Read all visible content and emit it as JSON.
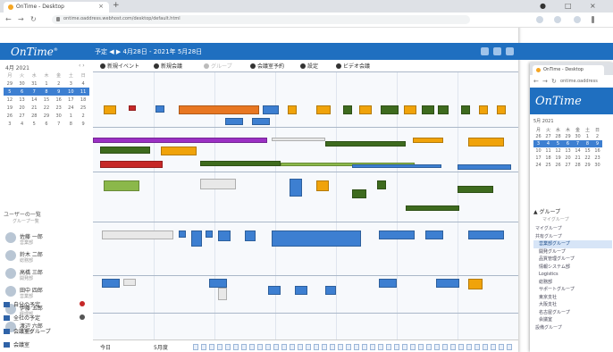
{
  "browser": {
    "tab_title": "OnTime - Desktop",
    "url": "ontime.oaddress.webhost.com/desktop/default.html"
  },
  "app": {
    "logo": "OnTime",
    "header_tools": "予定  ◀  ▶  4月28日 - 2021年 5月28日"
  },
  "mini_calendar": {
    "title": "4月 2021",
    "weekdays": [
      "月",
      "火",
      "水",
      "木",
      "金",
      "土",
      "日"
    ],
    "weeks": [
      [
        "29",
        "30",
        "31",
        "1",
        "2",
        "3",
        "4"
      ],
      [
        "5",
        "6",
        "7",
        "8",
        "9",
        "10",
        "11"
      ],
      [
        "12",
        "13",
        "14",
        "15",
        "16",
        "17",
        "18"
      ],
      [
        "19",
        "20",
        "21",
        "22",
        "23",
        "24",
        "25"
      ],
      [
        "26",
        "27",
        "28",
        "29",
        "30",
        "1",
        "2"
      ],
      [
        "3",
        "4",
        "5",
        "6",
        "7",
        "8",
        "9"
      ]
    ],
    "selected_week": 2
  },
  "sidebar": {
    "group_label": "ユーザーの一覧",
    "group_sub": "グループ一覧",
    "users": [
      {
        "name": "佐藤 一郎",
        "desc": "営業部"
      },
      {
        "name": "鈴木 二郎",
        "desc": "総務部"
      },
      {
        "name": "高橋 三郎",
        "desc": "開発部"
      },
      {
        "name": "田中 四郎",
        "desc": "営業部"
      },
      {
        "name": "伊藤 五郎",
        "desc": "経理部"
      },
      {
        "name": "渡辺 六郎",
        "desc": "人事部"
      }
    ],
    "footer": [
      {
        "label": "自分の予定",
        "dot": "#c62828"
      },
      {
        "label": "全社の予定",
        "dot": "#555555"
      },
      {
        "label": "会議室グループ",
        "dot": ""
      },
      {
        "label": "会議室",
        "dot": ""
      }
    ]
  },
  "toolbar": {
    "items": [
      "新規イベント",
      "新規会議",
      "グループ",
      "会議室予約",
      "設定",
      "ビデオ会議"
    ]
  },
  "timeline": {
    "label": "今日",
    "week_label": "5月度"
  },
  "second_window": {
    "tab_title": "OnTime - Desktop",
    "url": "ontime.oaddress",
    "logo": "OnTime",
    "cal_title": "5月 2021",
    "weeks": [
      [
        "月",
        "火",
        "水",
        "木",
        "金",
        "土",
        "日"
      ],
      [
        "26",
        "27",
        "28",
        "29",
        "30",
        "1",
        "2"
      ],
      [
        "3",
        "4",
        "5",
        "6",
        "7",
        "8",
        "9"
      ],
      [
        "10",
        "11",
        "12",
        "13",
        "14",
        "15",
        "16"
      ],
      [
        "17",
        "18",
        "19",
        "20",
        "21",
        "22",
        "23"
      ],
      [
        "24",
        "25",
        "26",
        "27",
        "28",
        "29",
        "30"
      ]
    ],
    "group_header": "グループ",
    "group_sub": "マイグループ",
    "groups": [
      {
        "label": "マイグループ",
        "kind": "cat"
      },
      {
        "label": "共有グループ",
        "kind": "cat"
      },
      {
        "label": "営業部グループ",
        "kind": "sel"
      },
      {
        "label": "開発グループ",
        "kind": ""
      },
      {
        "label": "品質管理グループ",
        "kind": ""
      },
      {
        "label": "情報システム部",
        "kind": ""
      },
      {
        "label": "Logistics",
        "kind": ""
      },
      {
        "label": "総務部",
        "kind": ""
      },
      {
        "label": "サポートグループ",
        "kind": ""
      },
      {
        "label": "東京支社",
        "kind": ""
      },
      {
        "label": "大阪支社",
        "kind": ""
      },
      {
        "label": "名古屋グループ",
        "kind": ""
      },
      {
        "label": "会議室",
        "kind": ""
      },
      {
        "label": "設備グループ",
        "kind": "cat"
      }
    ]
  }
}
